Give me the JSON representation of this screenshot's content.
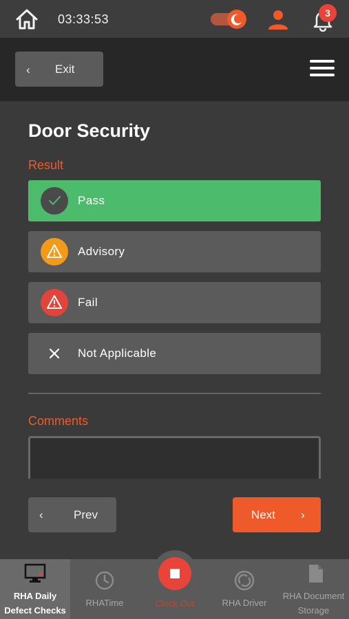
{
  "status_bar": {
    "time": "03:33:53",
    "notification_count": "3",
    "colors": {
      "accent": "#ef5a2b",
      "badge": "#e9443a"
    },
    "icons": [
      "home-icon",
      "dark-mode-toggle",
      "user-icon",
      "bell-icon"
    ]
  },
  "nav": {
    "exit_label": "Exit",
    "icons": [
      "chevron-left-icon",
      "hamburger-menu-icon"
    ]
  },
  "page": {
    "title": "Door Security",
    "result_label": "Result",
    "comments_label": "Comments",
    "comments_value": ""
  },
  "options": [
    {
      "label": "Pass",
      "icon": "check-icon",
      "selected": true,
      "color": "#4dbb6c"
    },
    {
      "label": "Advisory",
      "icon": "warning-icon",
      "selected": false,
      "color": "#f29a1a"
    },
    {
      "label": "Fail",
      "icon": "warning-icon",
      "selected": false,
      "color": "#e0443a"
    },
    {
      "label": "Not Applicable",
      "icon": "close-icon",
      "selected": false
    }
  ],
  "footer_nav": {
    "prev_label": "Prev",
    "next_label": "Next"
  },
  "tabbar": {
    "tabs": [
      {
        "label_line1": "RHA Daily",
        "label_line2": "Defect Checks",
        "icon": "monitor-icon",
        "active": true
      },
      {
        "label": "RHATime",
        "icon": "clock-icon",
        "active": false
      },
      {
        "label": "Clock Out",
        "icon": "stop-icon",
        "active": false
      },
      {
        "label": "RHA Driver",
        "icon": "refresh-icon",
        "active": false
      },
      {
        "label_line1": "RHA Document",
        "label_line2": "Storage",
        "icon": "document-icon",
        "active": false
      }
    ]
  }
}
